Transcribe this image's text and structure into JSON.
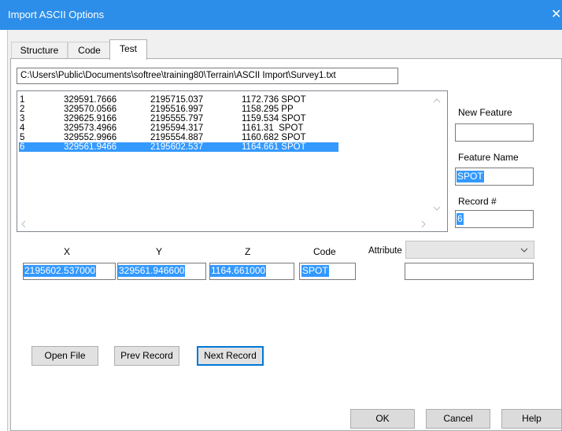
{
  "window": {
    "title": "Import ASCII Options",
    "close_glyph": "✕"
  },
  "tabs": [
    {
      "label": "Structure"
    },
    {
      "label": "Code"
    },
    {
      "label": "Test"
    }
  ],
  "file_path": "C:\\Users\\Public\\Documents\\softree\\training80\\Terrain\\ASCII Import\\Survey1.txt",
  "records": [
    {
      "num": "1",
      "y": "329591.7666",
      "x": "2195715.037",
      "z_code": "1172.736 SPOT"
    },
    {
      "num": "2",
      "y": "329570.0566",
      "x": "2195516.997",
      "z_code": "1158.295 PP"
    },
    {
      "num": "3",
      "y": "329625.9166",
      "x": "2195555.797",
      "z_code": "1159.534 SPOT"
    },
    {
      "num": "4",
      "y": "329573.4966",
      "x": "2195594.317",
      "z_code": "1161.31  SPOT"
    },
    {
      "num": "5",
      "y": "329552.9966",
      "x": "2195554.887",
      "z_code": "1160.682 SPOT"
    },
    {
      "num": "6",
      "y": "329561.9466",
      "x": "2195602.537",
      "z_code": "1164.661 SPOT"
    }
  ],
  "selected_record": 6,
  "right_panel": {
    "new_feature_label": "New Feature",
    "new_feature_value": "",
    "feature_name_label": "Feature Name",
    "feature_name_value": "SPOT",
    "record_num_label": "Record #",
    "record_num_value": "6"
  },
  "fields": {
    "x_label": "X",
    "x_value": "2195602.537000",
    "y_label": "Y",
    "y_value": "329561.946600",
    "z_label": "Z",
    "z_value": "1164.661000",
    "code_label": "Code",
    "code_value": "SPOT",
    "attribute_label": "Attribute",
    "attribute_value": ""
  },
  "buttons": {
    "open_file": "Open File",
    "prev_record": "Prev Record",
    "next_record": "Next Record",
    "ok": "OK",
    "cancel": "Cancel",
    "help": "Help"
  },
  "icons": {
    "scroll_up": "chevron-up-icon",
    "scroll_down": "chevron-down-icon",
    "scroll_left": "chevron-left-icon",
    "scroll_right": "chevron-right-icon",
    "combo_arrow": "chevron-down-icon"
  },
  "colors": {
    "titlebar": "#2c8ee8",
    "selection": "#3399ff",
    "default_button_border": "#0078d7"
  }
}
